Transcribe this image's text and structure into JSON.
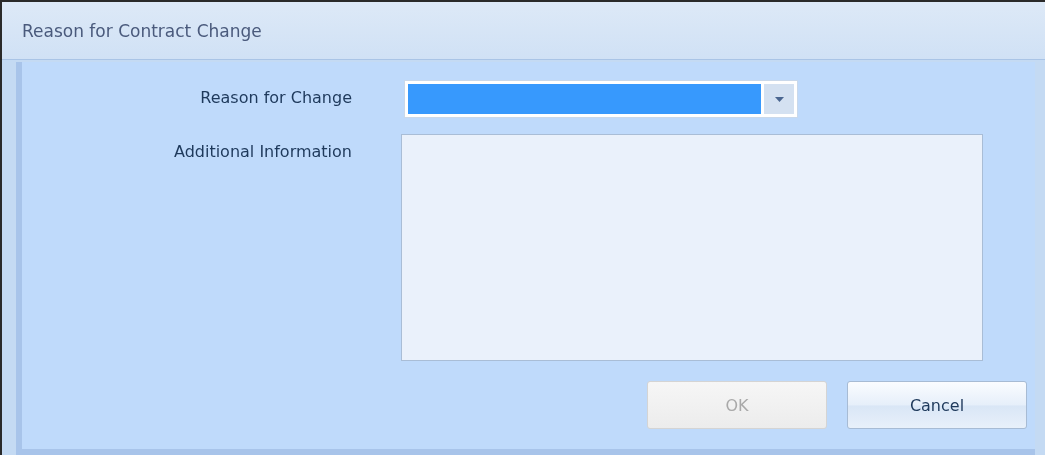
{
  "window": {
    "title": "Reason for Contract Change"
  },
  "fields": [
    {
      "kind": "dropdown",
      "label": "Reason for Change",
      "focused": true
    },
    {
      "kind": "textarea",
      "label": "Additional Information"
    }
  ],
  "buttons": [
    {
      "label": "OK",
      "disabled": true
    },
    {
      "label": "Cancel",
      "disabled": false
    }
  ]
}
